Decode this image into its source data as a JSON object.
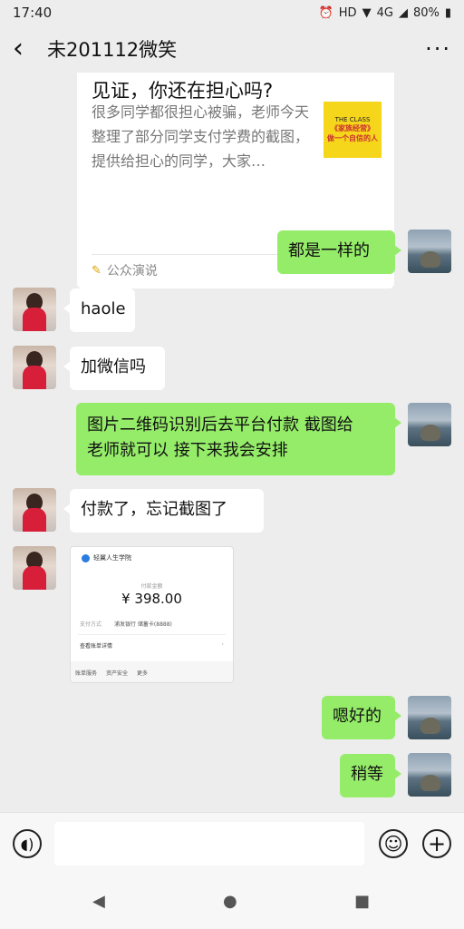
{
  "status": {
    "time": "17:40",
    "network": "4G",
    "battery": "80%"
  },
  "header": {
    "title": "未201112微笑",
    "back_icon": "back-arrow-icon",
    "more_icon": "more-icon"
  },
  "card": {
    "title": "见证，你还在担心吗?",
    "description": "很多同学都很担心被骗，老师今天整理了部分同学支付学费的截图，提供给担心的同学，大家…",
    "source": "公众演说",
    "thumb_line1": "THE CLASS",
    "thumb_line2": "《家族经营》",
    "thumb_line3": "做一个自信的人"
  },
  "messages": {
    "m1": "都是一样的",
    "m2": "haole",
    "m3": "加微信吗",
    "m4_line1": "图片二维码识别后去平台付款 截图给",
    "m4_line2": "老师就可以  接下来我会安排",
    "m5": "付款了，忘记截图了",
    "m7": "嗯好的",
    "m8": "稍等"
  },
  "payment_screenshot": {
    "merchant": "轻翼人生学院",
    "pay_label": "付款金额",
    "amount": "¥ 398.00",
    "method_label": "支付方式",
    "method_value": "浦发银行 储蓄卡(8888)",
    "detail_link": "查看账单详情",
    "footer_items": [
      "账单服务",
      "资产安全",
      "更多"
    ]
  },
  "colors": {
    "self_bubble": "#95ec69",
    "other_bubble": "#ffffff",
    "background": "#ededed"
  }
}
